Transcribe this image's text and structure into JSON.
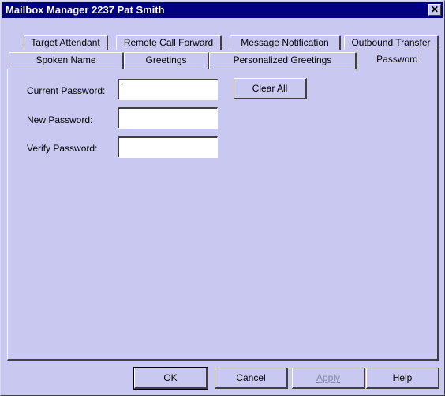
{
  "window": {
    "title": "Mailbox Manager 2237 Pat Smith",
    "close_label": "✕"
  },
  "tabs": {
    "row1": [
      {
        "label": "Target Attendant"
      },
      {
        "label": "Remote Call Forward"
      },
      {
        "label": "Message Notification"
      },
      {
        "label": "Outbound Transfer"
      }
    ],
    "row2": [
      {
        "label": "Spoken Name"
      },
      {
        "label": "Greetings"
      },
      {
        "label": "Personalized Greetings"
      },
      {
        "label": "Password",
        "active": true
      }
    ]
  },
  "form": {
    "current_password_label": "Current Password:",
    "current_password_value": "",
    "new_password_label": "New Password:",
    "new_password_value": "",
    "verify_password_label": "Verify Password:",
    "verify_password_value": "",
    "clear_all_label": "Clear All"
  },
  "footer": {
    "ok_label": "OK",
    "cancel_label": "Cancel",
    "apply_label": "Apply",
    "help_label": "Help"
  },
  "colors": {
    "title_bar": "#000080",
    "face": "#c8c8f0",
    "field": "#ffffff"
  }
}
